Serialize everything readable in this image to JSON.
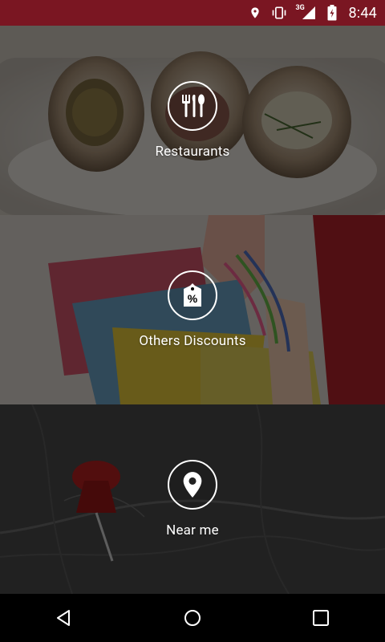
{
  "status_bar": {
    "time": "8:44",
    "network_label": "3G",
    "background_color": "#7a1622",
    "icons": [
      "location-icon",
      "vibrate-icon",
      "signal-3g-icon",
      "battery-charging-icon"
    ]
  },
  "categories": [
    {
      "label": "Restaurants",
      "icon": "cutlery-icon"
    },
    {
      "label": "Others Discounts",
      "icon": "discount-tag-icon"
    },
    {
      "label": "Near me",
      "icon": "location-pin-icon"
    }
  ],
  "navigation_bar": {
    "icons": [
      "back-icon",
      "home-icon",
      "recents-icon"
    ]
  }
}
